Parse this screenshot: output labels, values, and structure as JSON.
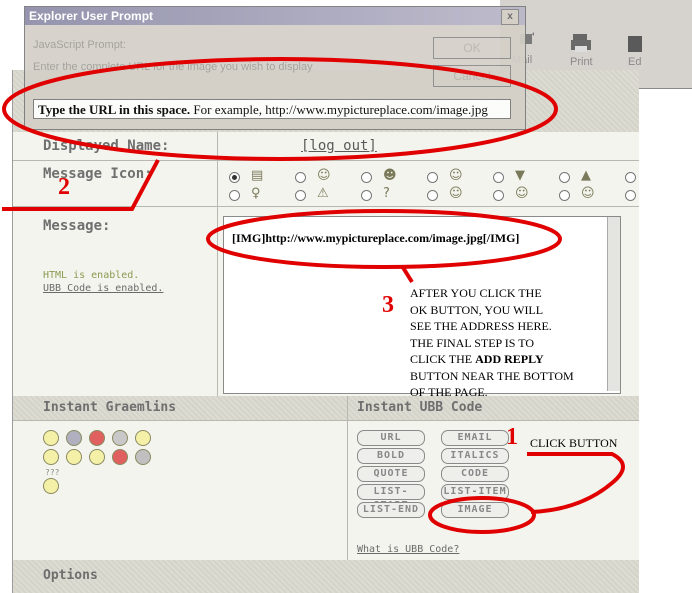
{
  "toolbar": {
    "items": [
      {
        "label": "Mail"
      },
      {
        "label": "Print"
      },
      {
        "label": "Ed"
      }
    ]
  },
  "dialog": {
    "title": "Explorer User Prompt",
    "close": "x",
    "prompt_line1": "JavaScript Prompt:",
    "prompt_line2": "Enter the complete URL for the image you wish to display",
    "ok": "OK",
    "cancel": "Cancel",
    "url_hint_bold": "Type the URL in this space.",
    "url_hint_rest": " For example, http://www.mypictureplace.com/image.jpg"
  },
  "form": {
    "displayed_name_label": "Displayed Name:",
    "logout_link": "[log out]",
    "message_icon_label": "Message Icon:",
    "message_label": "Message:",
    "html_status": "HTML is enabled.",
    "ubb_status": "UBB Code is enabled.",
    "message_value": "[IMG]http://www.mypictureplace.com/image.jpg[/IMG]",
    "instant_graemlins": "Instant Graemlins",
    "instant_ubb": "Instant UBB Code",
    "graemlin_extra": "???",
    "what_is_ubb": "What is UBB Code?",
    "options": "Options"
  },
  "icons": {
    "row1": [
      "notepad",
      "smile",
      "grin",
      "laugh",
      "thumbsdown",
      "thumbsup"
    ],
    "row2": [
      "lightbulb",
      "warning",
      "question",
      "cool",
      "smile-face",
      "bigsmile"
    ]
  },
  "graemlins": {
    "row1": [
      "smile",
      "frown",
      "mad",
      "cool",
      "wink"
    ],
    "row2": [
      "laugh",
      "shades",
      "tongue",
      "angry",
      "question"
    ],
    "row3": [
      "sad"
    ]
  },
  "ubb_buttons": [
    {
      "label": "URL"
    },
    {
      "label": "EMAIL"
    },
    {
      "label": "BOLD"
    },
    {
      "label": "ITALICS"
    },
    {
      "label": "QUOTE"
    },
    {
      "label": "CODE"
    },
    {
      "label": "LIST-START"
    },
    {
      "label": "LIST-ITEM"
    },
    {
      "label": "LIST-END"
    },
    {
      "label": "IMAGE"
    }
  ],
  "annotations": {
    "step1_num": "1",
    "step1_text": "CLICK BUTTON",
    "step2_num": "2",
    "step3_num": "3",
    "step3_lines": [
      "AFTER YOU CLICK THE",
      "OK BUTTON, YOU WILL",
      "SEE THE ADDRESS HERE.",
      "THE FINAL STEP IS TO",
      "CLICK THE ",
      "BUTTON  NEAR THE BOTTOM",
      "OF THE PAGE."
    ],
    "step3_bold": "ADD REPLY",
    "accent": "#e00000"
  }
}
